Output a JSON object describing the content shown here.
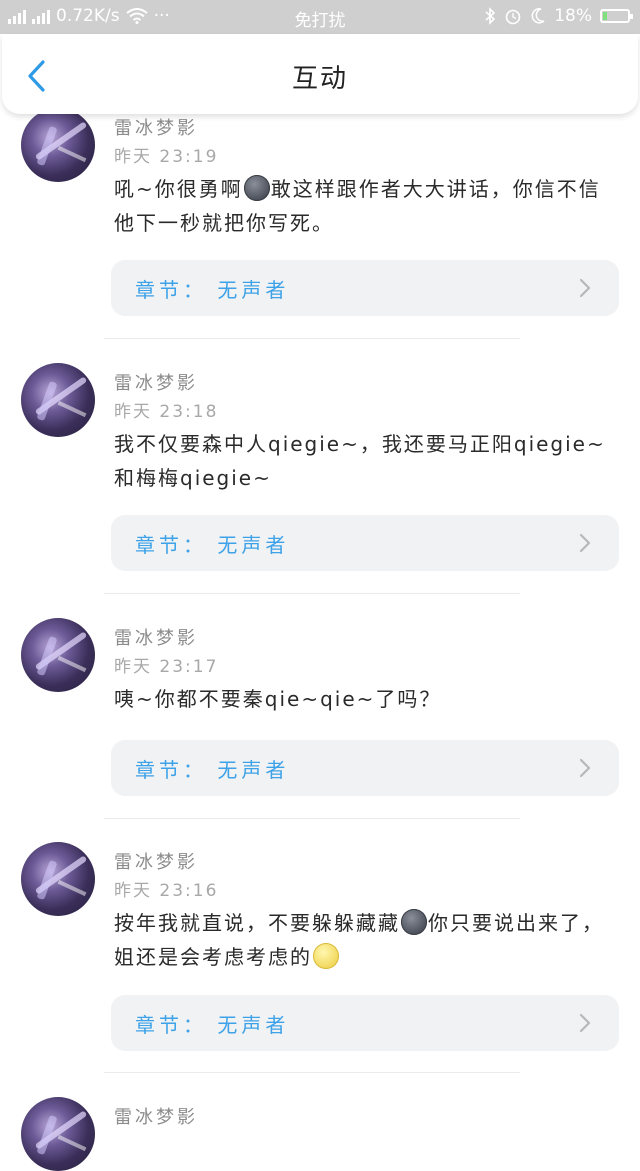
{
  "status_bar": {
    "network": "0.72K/s",
    "dots": "···",
    "mode": "免打扰",
    "battery": "18%",
    "battery_level": 0.18
  },
  "header": {
    "title": "互动"
  },
  "comments": [
    {
      "user": "雷冰梦影",
      "time": "昨天 23:19",
      "text_parts": [
        "吼~你很勇啊",
        "{moon-dark}",
        "敢这样跟作者大大讲话，你信不信他下一秒就把你写死。"
      ],
      "chapter": "章节： 无声者"
    },
    {
      "user": "雷冰梦影",
      "time": "昨天 23:18",
      "text_parts": [
        "我不仅要森中人qiegie~，我还要马正阳qiegie~和梅梅qiegie~"
      ],
      "chapter": "章节： 无声者"
    },
    {
      "user": "雷冰梦影",
      "time": "昨天 23:17",
      "text_parts": [
        "咦~你都不要秦qie~qie~了吗？"
      ],
      "chapter": "章节： 无声者"
    },
    {
      "user": "雷冰梦影",
      "time": "昨天 23:16",
      "text_parts": [
        "按年我就直说，不要躲躲藏藏",
        "{moon-dark}",
        "你只要说出来了，姐还是会考虑考虑的",
        "{moon-light}"
      ],
      "chapter": "章节： 无声者"
    },
    {
      "user": "雷冰梦影",
      "time": "",
      "text_parts": [],
      "chapter": ""
    }
  ],
  "colors": {
    "accent": "#3da2e8",
    "chapter_bg": "#f1f2f4",
    "status_bg": "#cfcfcf"
  }
}
